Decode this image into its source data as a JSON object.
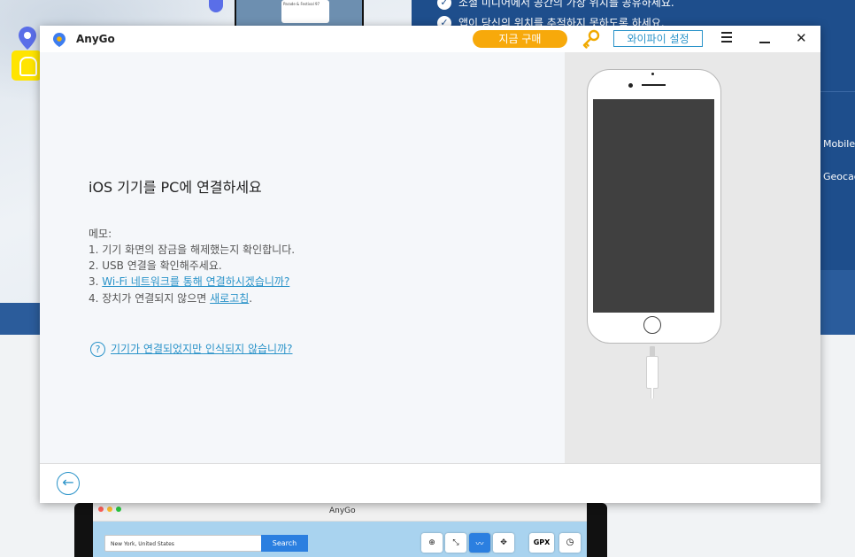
{
  "background": {
    "bullets": [
      "소셜 미디어에서 공간의 가장 위치를 공유하세요.",
      "앱이 당신의 위치를 추적하지 못하도록 하세요."
    ],
    "side_links": [
      "Mobile",
      "Geocac"
    ],
    "map_card_text": "Parade & Festival 97",
    "mac_app": {
      "title": "AnyGo",
      "search_value": "New York, United States",
      "search_button": "Search",
      "gpx_label": "GPX"
    }
  },
  "window": {
    "app_name": "AnyGo",
    "buy_button": "지금 구매",
    "wifi_button": "와이파이 설정",
    "heading": "iOS 기기를 PC에 연결하세요",
    "memo": {
      "title": "메모:",
      "line1": "1. 기기 화면의 잠금을 해제했는지 확인합니다.",
      "line2": "2. USB 연결을 확인해주세요.",
      "line3_prefix": "3. ",
      "line3_link": "Wi-Fi 네트워크를 통해 연결하시겠습니까?",
      "line4_prefix": "4. 장치가 연결되지 않으면 ",
      "line4_link": "새로고침",
      "line4_suffix": "."
    },
    "help_icon": "?",
    "help_link": "기기가 연결되었지만 인식되지 않습니까?",
    "back_icon": "←",
    "close_icon": "✕"
  },
  "colors": {
    "accent": "#2a93c9",
    "buy_button": "#f7a90b",
    "background_blue": "#1e4e8c"
  },
  "icons": [
    "location-pin-icon",
    "key-icon",
    "menu-icon",
    "minimize-icon",
    "close-icon",
    "help-icon",
    "back-arrow-icon"
  ]
}
